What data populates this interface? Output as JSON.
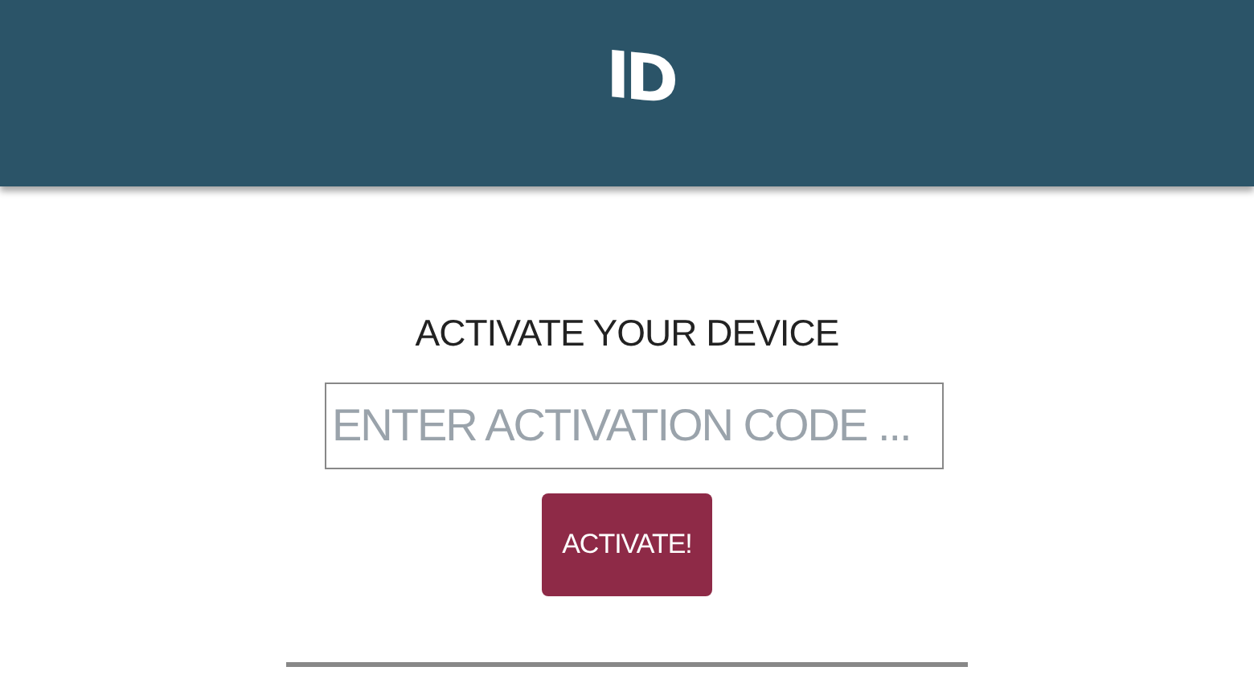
{
  "header": {
    "logo": "ID"
  },
  "activation": {
    "title": "ACTIVATE YOUR DEVICE",
    "placeholder": "ENTER ACTIVATION CODE ...",
    "button": "ACTIVATE!"
  }
}
